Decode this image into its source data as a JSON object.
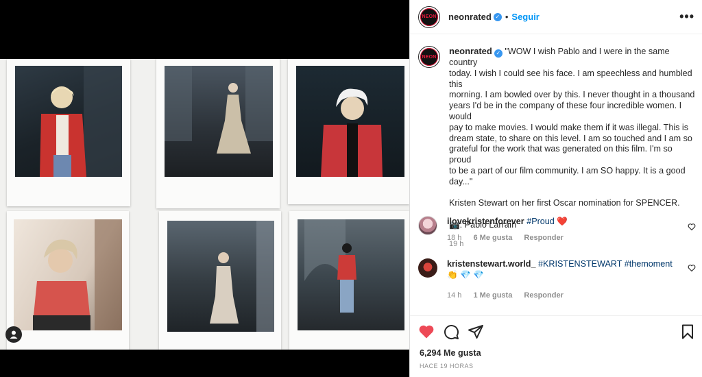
{
  "post": {
    "username": "neonrated",
    "follow_label": "Seguir",
    "more_label": "•••",
    "avatar_logo": "NEON",
    "caption_lines": [
      "\"WOW I wish Pablo and I were in the same country",
      "today. I wish I could see his face. I am speechless and humbled this",
      "morning. I am bowled over by this. I never thought in a thousand",
      "years I'd be in the company of these four incredible women. I would",
      "pay to make movies. I would make them if it was illegal. This is",
      "dream state, to share on this level. I am so touched and I am so",
      "grateful for the work that was generated on this film. I'm so proud",
      "to be a part of our film community. I am SO happy. It is a good",
      "day...\""
    ],
    "caption_line2": "Kristen Stewart on her first Oscar nomination for SPENCER.",
    "caption_line3": "📷: Pablo Larraín",
    "time": "19 h",
    "likes": "6,294 Me gusta",
    "posted_ago": "HACE 19 HORAS"
  },
  "comments": [
    {
      "user": "ilovekristenforever",
      "text": "#Proud ❤️",
      "time": "18 h",
      "likes": "6 Me gusta",
      "reply": "Responder"
    },
    {
      "user": "kristenstewart.world_",
      "text": "#KRISTENSTEWART #themoment 👏 💎 💎",
      "time": "14 h",
      "likes": "1 Me gusta",
      "reply": "Responder"
    }
  ],
  "icons": {
    "verified": "verified-badge-icon",
    "like": "heart-icon",
    "comment": "comment-icon",
    "share": "paper-plane-icon",
    "save": "bookmark-icon",
    "user_tag": "user-tag-icon"
  },
  "colors": {
    "accent_blue": "#0095f6",
    "like_red": "#ed4956",
    "neon_red": "#e8193c"
  }
}
